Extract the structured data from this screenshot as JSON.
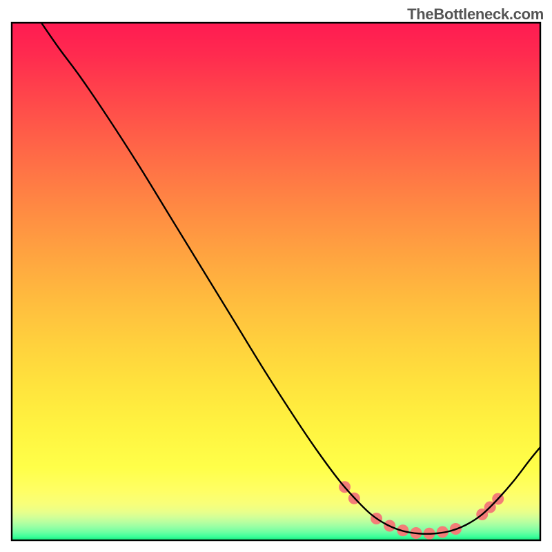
{
  "watermark": "TheBottleneck.com",
  "chart_data": {
    "type": "line",
    "title": "",
    "xlabel": "",
    "ylabel": "",
    "xlim": [
      0,
      100
    ],
    "ylim": [
      0,
      100
    ],
    "grid": false,
    "legend": false,
    "background": {
      "type": "vertical-gradient",
      "stops": [
        {
          "offset": 0.0,
          "color": "#ff1b52"
        },
        {
          "offset": 0.06,
          "color": "#ff2a4f"
        },
        {
          "offset": 0.14,
          "color": "#ff454b"
        },
        {
          "offset": 0.22,
          "color": "#ff5f48"
        },
        {
          "offset": 0.3,
          "color": "#ff7845"
        },
        {
          "offset": 0.38,
          "color": "#ff9042"
        },
        {
          "offset": 0.46,
          "color": "#ffa740"
        },
        {
          "offset": 0.54,
          "color": "#ffbd3e"
        },
        {
          "offset": 0.62,
          "color": "#ffd13d"
        },
        {
          "offset": 0.7,
          "color": "#ffe33d"
        },
        {
          "offset": 0.78,
          "color": "#fff340"
        },
        {
          "offset": 0.86,
          "color": "#ffff49"
        },
        {
          "offset": 0.905,
          "color": "#ffff65"
        },
        {
          "offset": 0.93,
          "color": "#f8ff7a"
        },
        {
          "offset": 0.945,
          "color": "#e9ff8a"
        },
        {
          "offset": 0.955,
          "color": "#d3ff97"
        },
        {
          "offset": 0.965,
          "color": "#b7ffa0"
        },
        {
          "offset": 0.975,
          "color": "#94ffa4"
        },
        {
          "offset": 0.985,
          "color": "#6affa2"
        },
        {
          "offset": 0.993,
          "color": "#3bff9a"
        },
        {
          "offset": 1.0,
          "color": "#15e57c"
        }
      ]
    },
    "curve": {
      "color": "#000000",
      "width": 2.4,
      "points": [
        {
          "x": 5.6,
          "y": 100.0
        },
        {
          "x": 9.0,
          "y": 95.0
        },
        {
          "x": 13.0,
          "y": 89.5
        },
        {
          "x": 18.0,
          "y": 82.0
        },
        {
          "x": 24.0,
          "y": 72.5
        },
        {
          "x": 30.0,
          "y": 62.5
        },
        {
          "x": 36.0,
          "y": 52.5
        },
        {
          "x": 42.0,
          "y": 42.5
        },
        {
          "x": 48.0,
          "y": 32.5
        },
        {
          "x": 54.0,
          "y": 23.0
        },
        {
          "x": 58.0,
          "y": 17.0
        },
        {
          "x": 62.0,
          "y": 11.5
        },
        {
          "x": 65.0,
          "y": 8.0
        },
        {
          "x": 68.0,
          "y": 5.0
        },
        {
          "x": 71.0,
          "y": 3.0
        },
        {
          "x": 74.0,
          "y": 1.8
        },
        {
          "x": 77.0,
          "y": 1.3
        },
        {
          "x": 80.0,
          "y": 1.3
        },
        {
          "x": 83.0,
          "y": 1.8
        },
        {
          "x": 86.0,
          "y": 3.0
        },
        {
          "x": 89.0,
          "y": 5.0
        },
        {
          "x": 92.0,
          "y": 8.0
        },
        {
          "x": 95.0,
          "y": 11.5
        },
        {
          "x": 98.0,
          "y": 15.5
        },
        {
          "x": 100.0,
          "y": 18.0
        }
      ]
    },
    "markers": {
      "color": "#f37d77",
      "radius": 8.5,
      "points": [
        {
          "x": 63.0,
          "y": 10.3
        },
        {
          "x": 64.8,
          "y": 8.1
        },
        {
          "x": 69.0,
          "y": 4.2
        },
        {
          "x": 71.5,
          "y": 2.8
        },
        {
          "x": 74.0,
          "y": 1.9
        },
        {
          "x": 76.5,
          "y": 1.4
        },
        {
          "x": 79.0,
          "y": 1.3
        },
        {
          "x": 81.5,
          "y": 1.6
        },
        {
          "x": 84.0,
          "y": 2.2
        },
        {
          "x": 89.0,
          "y": 5.0
        },
        {
          "x": 90.5,
          "y": 6.4
        },
        {
          "x": 92.0,
          "y": 8.0
        }
      ]
    }
  },
  "frame": {
    "stroke": "#000000",
    "strokeWidth": 2.4
  }
}
